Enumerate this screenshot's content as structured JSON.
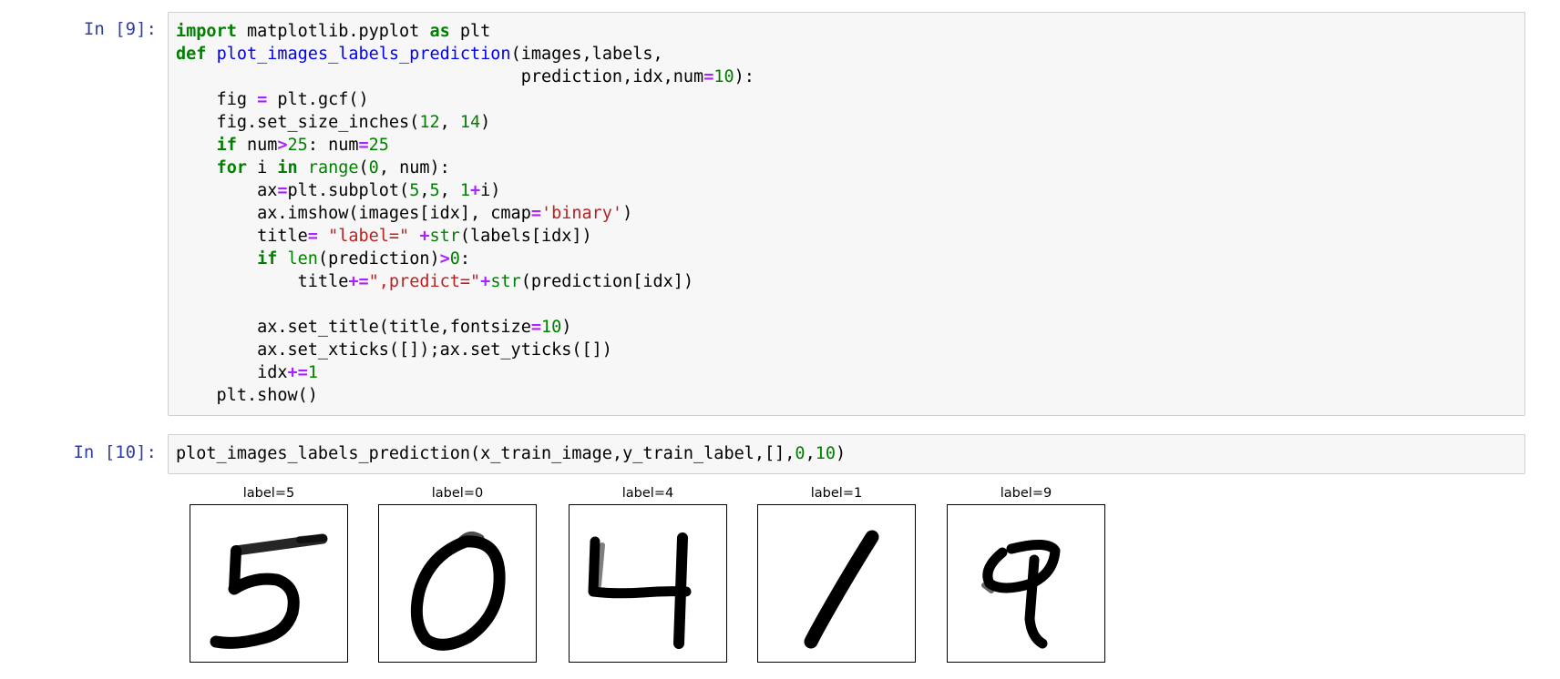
{
  "cells": [
    {
      "prompt": "In [9]:",
      "lines": [
        [
          [
            "k",
            "import"
          ],
          [
            "n",
            " matplotlib.pyplot "
          ],
          [
            "k",
            "as"
          ],
          [
            "n",
            " plt"
          ]
        ],
        [
          [
            "k",
            "def"
          ],
          [
            "n",
            " "
          ],
          [
            "def",
            "plot_images_labels_prediction"
          ],
          [
            "p",
            "(images,labels,"
          ]
        ],
        [
          [
            "n",
            "                                  prediction,idx,num"
          ],
          [
            "o",
            "="
          ],
          [
            "m",
            "10"
          ],
          [
            "p",
            "):"
          ]
        ],
        [
          [
            "n",
            "    fig "
          ],
          [
            "o",
            "="
          ],
          [
            "n",
            " plt.gcf()"
          ]
        ],
        [
          [
            "n",
            "    fig.set_size_inches("
          ],
          [
            "m",
            "12"
          ],
          [
            "p",
            ", "
          ],
          [
            "m",
            "14"
          ],
          [
            "p",
            ")"
          ]
        ],
        [
          [
            "n",
            "    "
          ],
          [
            "k",
            "if"
          ],
          [
            "n",
            " num"
          ],
          [
            "o",
            ">"
          ],
          [
            "m",
            "25"
          ],
          [
            "p",
            ": num"
          ],
          [
            "o",
            "="
          ],
          [
            "m",
            "25"
          ]
        ],
        [
          [
            "n",
            "    "
          ],
          [
            "k",
            "for"
          ],
          [
            "n",
            " i "
          ],
          [
            "k",
            "in"
          ],
          [
            "n",
            " "
          ],
          [
            "b",
            "range"
          ],
          [
            "p",
            "("
          ],
          [
            "m",
            "0"
          ],
          [
            "p",
            ", num):"
          ]
        ],
        [
          [
            "n",
            "        ax"
          ],
          [
            "o",
            "="
          ],
          [
            "n",
            "plt.subplot("
          ],
          [
            "m",
            "5"
          ],
          [
            "p",
            ","
          ],
          [
            "m",
            "5"
          ],
          [
            "p",
            ", "
          ],
          [
            "m",
            "1"
          ],
          [
            "o",
            "+"
          ],
          [
            "p",
            "i)"
          ]
        ],
        [
          [
            "n",
            "        ax.imshow(images[idx], cmap"
          ],
          [
            "o",
            "="
          ],
          [
            "s",
            "'binary'"
          ],
          [
            "p",
            ")"
          ]
        ],
        [
          [
            "n",
            "        title"
          ],
          [
            "o",
            "="
          ],
          [
            "n",
            " "
          ],
          [
            "s",
            "\"label=\""
          ],
          [
            "n",
            " "
          ],
          [
            "o",
            "+"
          ],
          [
            "b",
            "str"
          ],
          [
            "p",
            "(labels[idx])"
          ]
        ],
        [
          [
            "n",
            "        "
          ],
          [
            "k",
            "if"
          ],
          [
            "n",
            " "
          ],
          [
            "b",
            "len"
          ],
          [
            "p",
            "(prediction)"
          ],
          [
            "o",
            ">"
          ],
          [
            "m",
            "0"
          ],
          [
            "p",
            ":"
          ]
        ],
        [
          [
            "n",
            "            title"
          ],
          [
            "o",
            "+="
          ],
          [
            "s",
            "\",predict=\""
          ],
          [
            "o",
            "+"
          ],
          [
            "b",
            "str"
          ],
          [
            "p",
            "(prediction[idx])"
          ]
        ],
        [
          [
            "n",
            ""
          ]
        ],
        [
          [
            "n",
            "        ax.set_title(title,fontsize"
          ],
          [
            "o",
            "="
          ],
          [
            "m",
            "10"
          ],
          [
            "p",
            ")"
          ]
        ],
        [
          [
            "n",
            "        ax.set_xticks([]);ax.set_yticks([])"
          ]
        ],
        [
          [
            "n",
            "        idx"
          ],
          [
            "o",
            "+="
          ],
          [
            "m",
            "1"
          ]
        ],
        [
          [
            "n",
            "    plt.show()"
          ]
        ]
      ]
    },
    {
      "prompt": "In [10]:",
      "lines": [
        [
          [
            "n",
            "plot_images_labels_prediction(x_train_image,y_train_label,[],"
          ],
          [
            "m",
            "0"
          ],
          [
            "p",
            ","
          ],
          [
            "m",
            "10"
          ],
          [
            "p",
            ")"
          ]
        ]
      ]
    }
  ],
  "output": {
    "panels": [
      {
        "title": "label=5",
        "digit": "5"
      },
      {
        "title": "label=0",
        "digit": "0"
      },
      {
        "title": "label=4",
        "digit": "4"
      },
      {
        "title": "label=1",
        "digit": "1"
      },
      {
        "title": "label=9",
        "digit": "9"
      }
    ]
  }
}
